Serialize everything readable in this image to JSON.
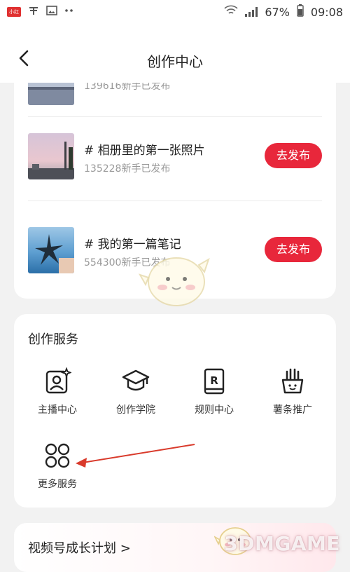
{
  "status_bar": {
    "app_badge": "小红书",
    "battery": "67%",
    "time": "09:08"
  },
  "header": {
    "title": "创作中心"
  },
  "tasks": [
    {
      "title": "# 相册里的第一张照片",
      "meta": "135228新手已发布",
      "button": "去发布"
    },
    {
      "title": "# 我的第一篇笔记",
      "meta": "554300新手已发布",
      "button": "去发布"
    }
  ],
  "partial_task": {
    "meta": "139616新手已发布"
  },
  "services": {
    "title": "创作服务",
    "items": [
      {
        "label": "主播中心",
        "icon": "streamer-icon"
      },
      {
        "label": "创作学院",
        "icon": "academy-icon"
      },
      {
        "label": "规则中心",
        "icon": "rules-icon"
      },
      {
        "label": "薯条推广",
        "icon": "fries-icon"
      },
      {
        "label": "更多服务",
        "icon": "more-grid-icon"
      }
    ]
  },
  "growth": {
    "title": "视频号成长计划 >"
  },
  "watermark": "3DMGAME",
  "colors": {
    "accent": "#e8273b",
    "background": "#f2f2f2",
    "annotation": "#d93a2b"
  }
}
